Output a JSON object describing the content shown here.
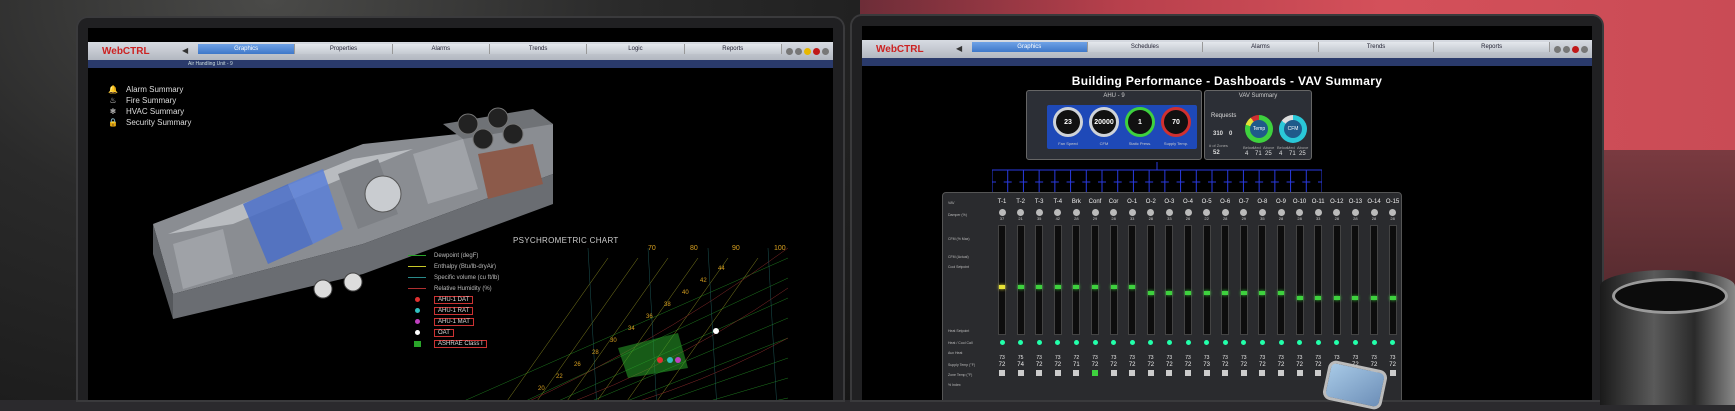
{
  "left": {
    "logo": "WebCTRL",
    "tabs": [
      "Graphics",
      "Properties",
      "Alarms",
      "Trends",
      "Logic",
      "Reports"
    ],
    "active_tab": 0,
    "breadcrumb": "Air Handling Unit - 9",
    "menu": [
      {
        "icon": "bell-icon",
        "glyph": "🔔",
        "label": "Alarm Summary"
      },
      {
        "icon": "fire-icon",
        "glyph": "♨",
        "label": "Fire Summary"
      },
      {
        "icon": "hvac-icon",
        "glyph": "❄",
        "label": "HVAC Summary"
      },
      {
        "icon": "lock-icon",
        "glyph": "🔒",
        "label": "Security Summary"
      }
    ],
    "chart_title": "PSYCHROMETRIC CHART",
    "legend": [
      {
        "label": "Dewpoint (degF)",
        "kind": "line",
        "color": "#2aa52a"
      },
      {
        "label": "Enthalpy (Btu/lb-dryAir)",
        "kind": "line",
        "color": "#c8c828"
      },
      {
        "label": "Specific volume (cu ft/lb)",
        "kind": "line",
        "color": "#2a8a8a"
      },
      {
        "label": "Relative Humidity (%)",
        "kind": "line",
        "color": "#b03030"
      },
      {
        "label": "AHU-1 DAT",
        "kind": "dot",
        "color": "#e03030"
      },
      {
        "label": "AHU-1 RAT",
        "kind": "dot",
        "color": "#30c0c0"
      },
      {
        "label": "AHU-1 MAT",
        "kind": "dot",
        "color": "#c040c0"
      },
      {
        "label": "OAT",
        "kind": "dot",
        "color": "#ffffff"
      },
      {
        "label": "ASHRAE Class I",
        "kind": "square",
        "color": "#2aa52a"
      }
    ],
    "temp_ticks": [
      "70",
      "80",
      "90",
      "100"
    ],
    "enthalpy_ticks": [
      "44",
      "42",
      "40",
      "38",
      "36",
      "34",
      "30",
      "28",
      "26",
      "22",
      "20"
    ]
  },
  "right": {
    "logo": "WebCTRL",
    "tabs": [
      "Graphics",
      "Schedules",
      "Alarms",
      "Trends",
      "Reports"
    ],
    "active_tab": 0,
    "title": "Building Performance  -  Dashboards  -  VAV Summary",
    "ahu_panel": {
      "title": "AHU - 9",
      "gauges": [
        {
          "value": "23",
          "label": "Fan Speed"
        },
        {
          "value": "20000",
          "label": "CFM"
        },
        {
          "value": "1",
          "label": "Static Press."
        },
        {
          "value": "70",
          "label": "Supply Temp."
        }
      ]
    },
    "vav_panel": {
      "title": "VAV Summary",
      "requests_label": "Requests",
      "req_values": [
        "310",
        "0"
      ],
      "zones_label": "# of Zones",
      "zones_value": "52",
      "ring1": "Temp",
      "ring2": "CFM",
      "col_labels": [
        "Below",
        "Med",
        "Above"
      ],
      "ring1_values": [
        "4",
        "71",
        "25"
      ],
      "ring2_values": [
        "4",
        "71",
        "25"
      ]
    },
    "board": {
      "row_labels": [
        "VAV",
        "Damper (%)",
        "CFM (% Max)",
        "CFM (Actual)",
        "Cool Setpoint",
        "Heat Setpoint",
        "Heat / Cool Call",
        "Aux Heat",
        "Supply Temp (°F)",
        "Zone Temp (°F)",
        "% Index"
      ],
      "columns": [
        {
          "name": "T-1",
          "damper": "37",
          "zone": "72",
          "supply": "73",
          "led": 0.55,
          "color": "y"
        },
        {
          "name": "T-2",
          "damper": "21",
          "zone": "74",
          "supply": "75",
          "led": 0.55,
          "color": "g"
        },
        {
          "name": "T-3",
          "damper": "35",
          "zone": "72",
          "supply": "73",
          "led": 0.55,
          "color": "g"
        },
        {
          "name": "T-4",
          "damper": "42",
          "zone": "72",
          "supply": "73",
          "led": 0.55,
          "color": "g"
        },
        {
          "name": "Brk",
          "damper": "28",
          "zone": "71",
          "supply": "72",
          "led": 0.55,
          "color": "g"
        },
        {
          "name": "Conf",
          "damper": "29",
          "zone": "72",
          "supply": "73",
          "led": 0.55,
          "color": "g"
        },
        {
          "name": "Cor",
          "damper": "28",
          "zone": "72",
          "supply": "73",
          "led": 0.55,
          "color": "g"
        },
        {
          "name": "O-1",
          "damper": "33",
          "zone": "72",
          "supply": "73",
          "led": 0.55,
          "color": "g"
        },
        {
          "name": "O-2",
          "damper": "28",
          "zone": "72",
          "supply": "73",
          "led": 0.6,
          "color": "g"
        },
        {
          "name": "O-3",
          "damper": "33",
          "zone": "72",
          "supply": "73",
          "led": 0.6,
          "color": "g"
        },
        {
          "name": "O-4",
          "damper": "26",
          "zone": "72",
          "supply": "73",
          "led": 0.6,
          "color": "g"
        },
        {
          "name": "O-5",
          "damper": "22",
          "zone": "73",
          "supply": "73",
          "led": 0.6,
          "color": "g"
        },
        {
          "name": "O-6",
          "damper": "28",
          "zone": "72",
          "supply": "73",
          "led": 0.6,
          "color": "g"
        },
        {
          "name": "O-7",
          "damper": "29",
          "zone": "72",
          "supply": "73",
          "led": 0.6,
          "color": "g"
        },
        {
          "name": "O-8",
          "damper": "35",
          "zone": "72",
          "supply": "73",
          "led": 0.6,
          "color": "g"
        },
        {
          "name": "O-9",
          "damper": "28",
          "zone": "72",
          "supply": "73",
          "led": 0.6,
          "color": "g"
        },
        {
          "name": "O-10",
          "damper": "28",
          "zone": "72",
          "supply": "73",
          "led": 0.65,
          "color": "g"
        },
        {
          "name": "O-11",
          "damper": "33",
          "zone": "72",
          "supply": "73",
          "led": 0.65,
          "color": "g"
        },
        {
          "name": "O-12",
          "damper": "28",
          "zone": "72",
          "supply": "73",
          "led": 0.65,
          "color": "g"
        },
        {
          "name": "O-13",
          "damper": "28",
          "zone": "72",
          "supply": "73",
          "led": 0.65,
          "color": "g"
        },
        {
          "name": "O-14",
          "damper": "28",
          "zone": "72",
          "supply": "73",
          "led": 0.65,
          "color": "g"
        },
        {
          "name": "O-15",
          "damper": "28",
          "zone": "72",
          "supply": "73",
          "led": 0.65,
          "color": "g"
        }
      ]
    }
  }
}
